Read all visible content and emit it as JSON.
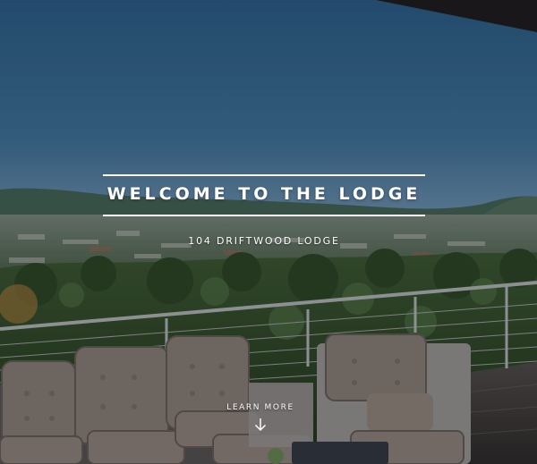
{
  "hero": {
    "title": "WELCOME TO THE LODGE",
    "subtitle": "104 DRIFTWOOD LODGE",
    "cta_label": "LEARN MORE",
    "cta_icon": "arrow-down-icon"
  },
  "colors": {
    "sky": "#2d5a7e",
    "text": "#ffffff",
    "foliage": "#2f4424",
    "cushion": "#7b6f66"
  }
}
